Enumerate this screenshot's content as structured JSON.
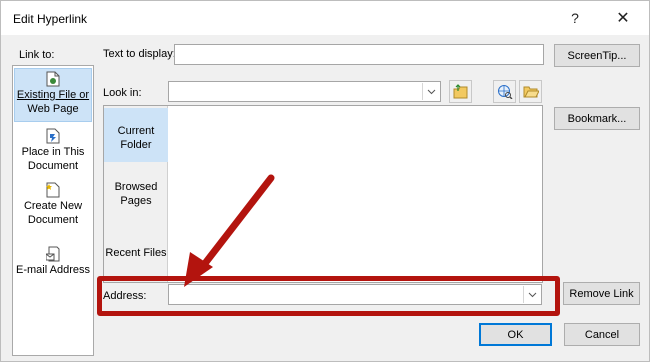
{
  "dialog": {
    "title": "Edit Hyperlink",
    "help_glyph": "?",
    "close_glyph": "✕"
  },
  "link_to": {
    "label": "Link to:",
    "items": [
      {
        "line1": "Existing File or",
        "line2": "Web Page",
        "icon": "existing-file-icon",
        "active": true
      },
      {
        "line1": "Place in This",
        "line2": "Document",
        "icon": "place-in-document-icon",
        "active": false
      },
      {
        "line1": "Create New",
        "line2": "Document",
        "icon": "new-document-icon",
        "active": false
      },
      {
        "line1": "E-mail Address",
        "line2": "",
        "icon": "email-icon",
        "active": false
      }
    ]
  },
  "text_to_display": {
    "label": "Text to display:",
    "value": ""
  },
  "screentip_button": "ScreenTip...",
  "look_in": {
    "label": "Look in:",
    "value": ""
  },
  "bookmark_button": "Bookmark...",
  "browse_tabs": [
    {
      "line1": "Current",
      "line2": "Folder",
      "active": true
    },
    {
      "line1": "Browsed",
      "line2": "Pages",
      "active": false
    },
    {
      "line1": "Recent Files",
      "line2": "",
      "active": false
    }
  ],
  "address": {
    "label": "Address:",
    "value": ""
  },
  "remove_link_button": "Remove Link",
  "ok_button": "OK",
  "cancel_button": "Cancel",
  "colors": {
    "highlight": "#b3140e",
    "selected_bg": "#cde3f7",
    "default_button_border": "#0078d7"
  }
}
